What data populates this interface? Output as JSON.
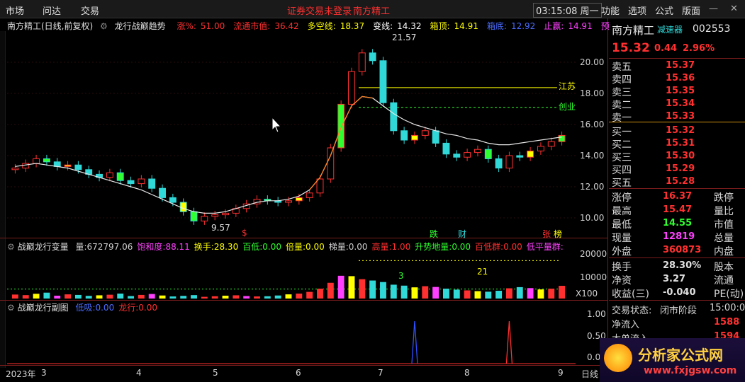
{
  "menubar": {
    "left": [
      "市场",
      "问达",
      "交易"
    ],
    "center_warning": "证券交易未登录",
    "center_stock": "南方精工",
    "time": "03:15:08 周一",
    "right": [
      "功能",
      "选项",
      "公式",
      "版面"
    ]
  },
  "main_chart": {
    "stock_title": "南方精工(日线,前复权)",
    "indicator_name": "龙行战巅趋势",
    "stats": [
      {
        "label": "涨%:",
        "value": "51.00",
        "color": "#ff3030"
      },
      {
        "label": "流通市值:",
        "value": "36.42",
        "color": "#ff3030"
      },
      {
        "label": "多空线:",
        "value": "18.37",
        "color": "#ffff00"
      },
      {
        "label": "变线:",
        "value": "14.32",
        "color": "#ffffff"
      },
      {
        "label": "箱顶:",
        "value": "14.91",
        "color": "#ffff00"
      },
      {
        "label": "箱底:",
        "value": "12.92",
        "color": "#4a6cff"
      },
      {
        "label": "止赢:",
        "value": "14.91",
        "color": "#ff40ff"
      },
      {
        "label": "预测",
        "value": "",
        "color": "#ff40ff"
      }
    ],
    "y_ticks": [
      "20.00",
      "18.00",
      "16.00",
      "14.00",
      "12.00",
      "10.00"
    ],
    "y_values": [
      20,
      18,
      16,
      14,
      12,
      10
    ],
    "high_label": "21.57",
    "low_label": "9.57",
    "tags": {
      "jiangsu": "江苏",
      "chuangye": "创业",
      "dollar": "$",
      "die": "跌",
      "cai": "财",
      "zhang": "张",
      "rank": "榜"
    }
  },
  "vol_panel": {
    "title": "战巅龙行变量",
    "stats": [
      {
        "label": "量:",
        "value": "672797.06",
        "color": "#d0d0d0"
      },
      {
        "label": "饱和度:",
        "value": "88.11",
        "color": "#ff40ff"
      },
      {
        "label": "换手:",
        "value": "28.30",
        "color": "#ffff00"
      },
      {
        "label": "百低:",
        "value": "0.00",
        "color": "#30ff30"
      },
      {
        "label": "倍量:",
        "value": "0.00",
        "color": "#ffff00"
      },
      {
        "label": "梯量:",
        "value": "0.00",
        "color": "#d0d0d0"
      },
      {
        "label": "高量:",
        "value": "1.00",
        "color": "#ff3030"
      },
      {
        "label": "升势地量:",
        "value": "0.00",
        "color": "#30ff30"
      },
      {
        "label": "百低群:",
        "value": "0.00",
        "color": "#ff3030"
      },
      {
        "label": "低平量群:",
        "value": "",
        "color": "#ff40ff"
      }
    ],
    "y_ticks": [
      "20000",
      "10000",
      "X100"
    ],
    "marker_21": "21",
    "marker_3": "3"
  },
  "sub_panel": {
    "title": "战巅龙行副图",
    "stats": [
      {
        "label": "低吸:",
        "value": "0.00",
        "color": "#4a6cff"
      },
      {
        "label": "龙行:",
        "value": "0.00",
        "color": "#ff3030"
      }
    ],
    "y_ticks": [
      "1.00",
      "0.50",
      "0.00"
    ]
  },
  "x_axis": {
    "labels": [
      "2023年",
      "3",
      "4",
      "5",
      "6",
      "7",
      "8",
      "9"
    ],
    "right_label": "日线"
  },
  "quote": {
    "name": "南方精工",
    "badge": "减速器",
    "code": "002553",
    "price": "15.32",
    "change": "0.44",
    "change_pct": "2.96%",
    "asks": [
      {
        "label": "卖五",
        "price": "15.37"
      },
      {
        "label": "卖四",
        "price": "15.36"
      },
      {
        "label": "卖三",
        "price": "15.35"
      },
      {
        "label": "卖二",
        "price": "15.34"
      },
      {
        "label": "卖一",
        "price": "15.33"
      }
    ],
    "bids": [
      {
        "label": "买一",
        "price": "15.32"
      },
      {
        "label": "买二",
        "price": "15.31"
      },
      {
        "label": "买三",
        "price": "15.30"
      },
      {
        "label": "买四",
        "price": "15.29"
      },
      {
        "label": "买五",
        "price": "15.28"
      }
    ],
    "stats": [
      {
        "label": "涨停",
        "value": "16.37",
        "label2": "跌停"
      },
      {
        "label": "最高",
        "value": "15.47",
        "label2": "量比"
      },
      {
        "label": "最低",
        "value": "14.55",
        "label2": "市值"
      },
      {
        "label": "现量",
        "value": "12819",
        "label2": "总量"
      },
      {
        "label": "外盘",
        "value": "360873",
        "label2": "内盘"
      }
    ],
    "stats2": [
      {
        "label": "换手",
        "value": "28.30%",
        "label2": "股本"
      },
      {
        "label": "净资",
        "value": "3.27",
        "label2": "流通"
      },
      {
        "label": "收益(三)",
        "value": "-0.040",
        "label2": "PE(动)"
      }
    ],
    "trade_status_label": "交易状态:",
    "trade_status_value": "闭市阶段",
    "trade_time": "15:00:0",
    "flow": [
      {
        "label": "净流入",
        "value": "1588"
      },
      {
        "label": "大单流入",
        "value": "1594"
      }
    ]
  },
  "watermark": {
    "cn": "分析家公式网",
    "url": "www.fxjgsw.com"
  },
  "colors": {
    "up": "#ff3030",
    "down": "#30d8d8",
    "frame": "#7a1c1c",
    "price_up": "#ff3030"
  },
  "chart_data": {
    "type": "candlestick",
    "x": [
      "2023-02",
      "2023-03",
      "2023-04",
      "2023-05",
      "2023-06",
      "2023-07",
      "2023-08",
      "2023-09"
    ],
    "ylim": [
      9,
      22
    ],
    "annotations": {
      "high": 21.57,
      "low": 9.57,
      "resistance_1": 18.37,
      "resistance_2": 17.1
    },
    "close": [
      13.2,
      13.5,
      13.8,
      13.6,
      13.3,
      13.4,
      13.1,
      12.8,
      12.6,
      12.9,
      12.4,
      12.2,
      12.5,
      11.9,
      11.3,
      11.0,
      10.4,
      9.8,
      10.1,
      10.2,
      10.3,
      10.6,
      10.9,
      11.2,
      11.1,
      11.0,
      11.1,
      11.3,
      11.6,
      12.5,
      14.5,
      17.3,
      19.4,
      20.6,
      20.1,
      17.4,
      15.6,
      15.0,
      15.3,
      15.6,
      14.8,
      14.1,
      13.9,
      14.2,
      14.4,
      13.8,
      13.2,
      14.0,
      13.9,
      14.3,
      14.6,
      14.9,
      15.3
    ],
    "ma": [
      13.3,
      13.4,
      13.5,
      13.4,
      13.3,
      13.2,
      13.0,
      12.8,
      12.6,
      12.4,
      12.2,
      12.0,
      11.8,
      11.5,
      11.2,
      10.9,
      10.6,
      10.4,
      10.3,
      10.3,
      10.4,
      10.6,
      10.8,
      11.0,
      11.1,
      11.1,
      11.2,
      11.4,
      11.8,
      12.6,
      14.0,
      15.8,
      17.2,
      17.8,
      17.7,
      17.2,
      16.7,
      16.3,
      16.0,
      15.8,
      15.6,
      15.4,
      15.3,
      15.1,
      15.0,
      14.8,
      14.7,
      14.7,
      14.8,
      14.9,
      15.0,
      15.1,
      15.2
    ],
    "volume_ylim": [
      0,
      25000
    ],
    "volume": [
      2100,
      1800,
      2500,
      3100,
      1500,
      2200,
      1900,
      1400,
      1700,
      2000,
      2600,
      1300,
      1900,
      2400,
      1600,
      1100,
      1400,
      1800,
      900,
      1200,
      1500,
      1700,
      1300,
      1100,
      1200,
      1600,
      2200,
      2600,
      3500,
      5200,
      8300,
      12000,
      11800,
      10200,
      9500,
      8700,
      7300,
      6800,
      5900,
      6500,
      6100,
      5200,
      4700,
      4300,
      3900,
      3600,
      4100,
      5400,
      6000,
      5500,
      4800,
      5200,
      6700
    ],
    "sub_ylim": [
      0,
      1.2
    ],
    "sub_blue_peak_index": 38,
    "sub_red_peak_index": 47
  }
}
